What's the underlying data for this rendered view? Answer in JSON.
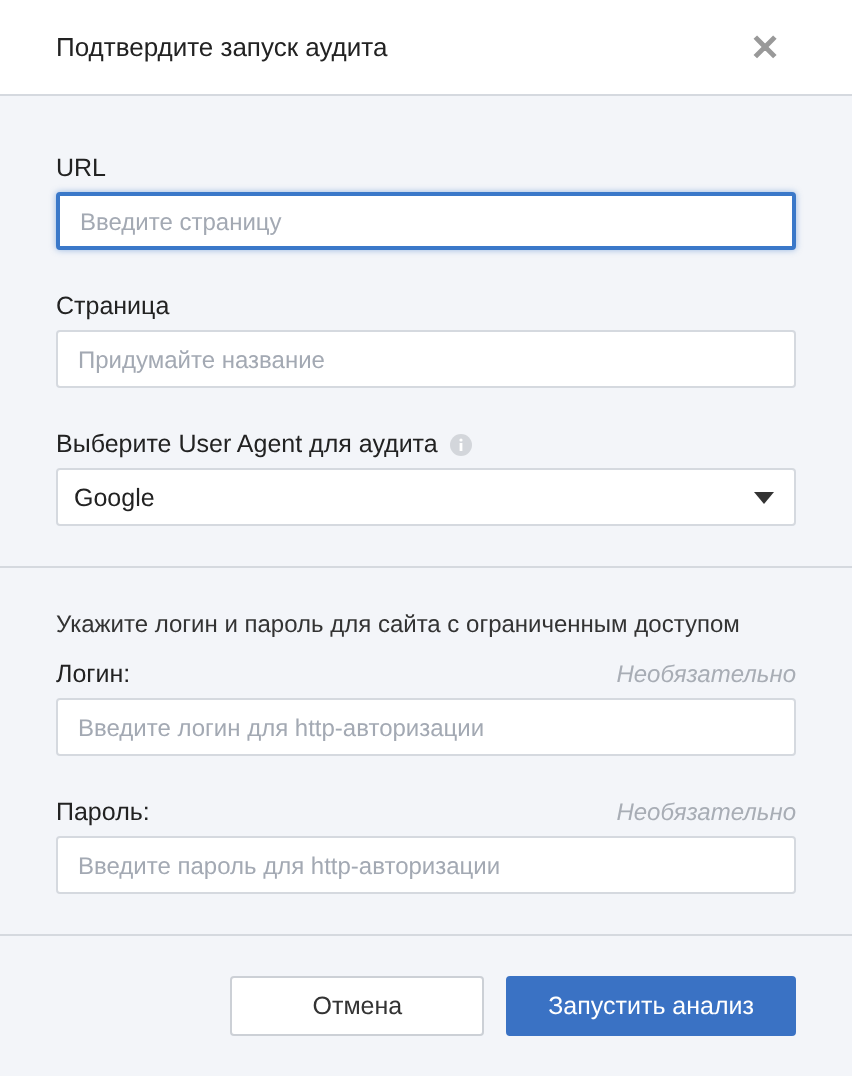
{
  "dialog": {
    "title": "Подтвердите запуск аудита",
    "close_glyph": "✕"
  },
  "audit_fields": [
    {
      "kind": "input",
      "label": "URL",
      "placeholder": "Введите страницу",
      "focused": true,
      "info": false
    },
    {
      "kind": "input",
      "label": "Страница",
      "placeholder": "Придумайте название",
      "focused": false,
      "info": false
    },
    {
      "kind": "select",
      "label": "Выберите User Agent для аудита",
      "value": "Google",
      "info": true
    }
  ],
  "auth": {
    "note": "Укажите логин и пароль для сайта с ограниченным доступом",
    "fields": [
      {
        "label": "Логин:",
        "hint": "Необязательно",
        "placeholder": "Введите логин для http-авторизации"
      },
      {
        "label": "Пароль:",
        "hint": "Необязательно",
        "placeholder": "Введите пароль для http-авторизации"
      }
    ]
  },
  "buttons": [
    {
      "label": "Отмена",
      "kind": "secondary"
    },
    {
      "label": "Запустить анализ",
      "kind": "primary"
    }
  ]
}
